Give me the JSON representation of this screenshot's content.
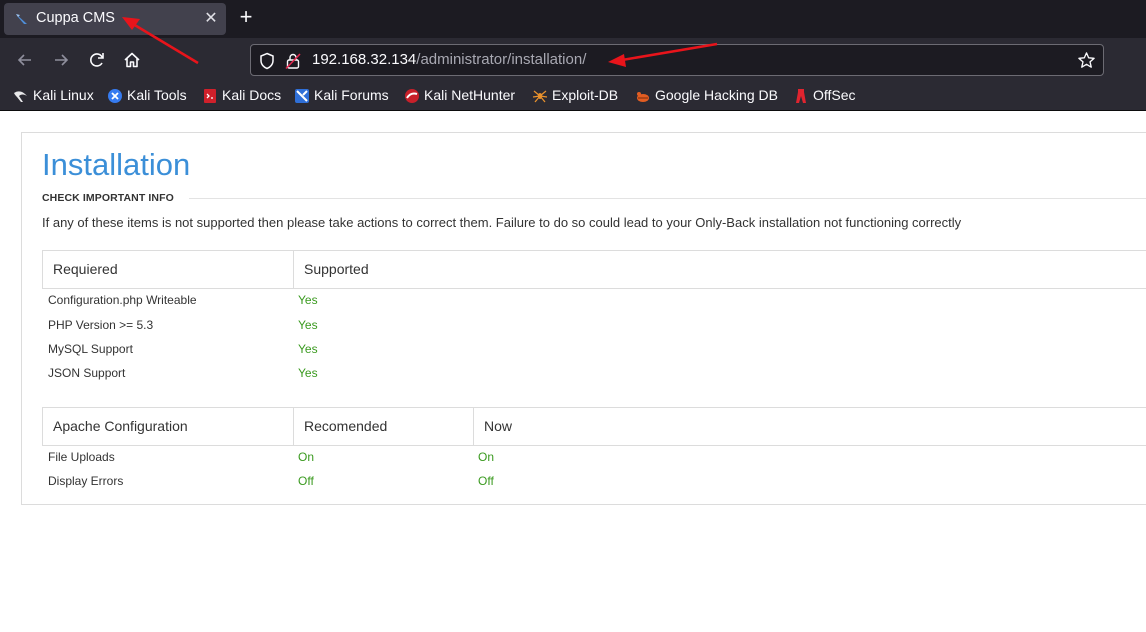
{
  "browser": {
    "tab_title": "Cuppa CMS",
    "url_host": "192.168.32.134",
    "url_path": "/administrator/installation/",
    "bookmarks": [
      {
        "label": "Kali Linux",
        "icon": "kali-dragon-icon"
      },
      {
        "label": "Kali Tools",
        "icon": "kali-tools-icon"
      },
      {
        "label": "Kali Docs",
        "icon": "kali-docs-icon"
      },
      {
        "label": "Kali Forums",
        "icon": "kali-forums-icon"
      },
      {
        "label": "Kali NetHunter",
        "icon": "nethunter-icon"
      },
      {
        "label": "Exploit-DB",
        "icon": "exploit-db-icon"
      },
      {
        "label": "Google Hacking DB",
        "icon": "ghdb-icon"
      },
      {
        "label": "OffSec",
        "icon": "offsec-icon"
      }
    ]
  },
  "page": {
    "title": "Installation",
    "section_title": "CHECK IMPORTANT INFO",
    "intro": "If any of these items is not supported then please take actions to correct them. Failure to do so could lead to your Only-Back installation not functioning correctly",
    "requirements": {
      "headers": [
        "Requiered",
        "Supported"
      ],
      "rows": [
        {
          "name": "Configuration.php Writeable",
          "status": "Yes"
        },
        {
          "name": "PHP Version >= 5.3",
          "status": "Yes"
        },
        {
          "name": "MySQL Support",
          "status": "Yes"
        },
        {
          "name": "JSON Support",
          "status": "Yes"
        }
      ]
    },
    "apache": {
      "headers": [
        "Apache Configuration",
        "Recomended",
        "Now"
      ],
      "rows": [
        {
          "name": "File Uploads",
          "recommended": "On",
          "now": "On"
        },
        {
          "name": "Display Errors",
          "recommended": "Off",
          "now": "Off"
        }
      ]
    }
  },
  "colors": {
    "accent": "#3b8fd8",
    "status_ok": "#3a9a1f",
    "annotation_arrow": "#e8141b"
  }
}
